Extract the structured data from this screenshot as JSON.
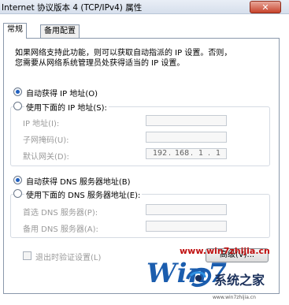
{
  "window": {
    "title": "Internet 协议版本 4 (TCP/IPv4) 属性",
    "close_glyph": "✕"
  },
  "tabs": [
    {
      "label": "常规",
      "selected": true
    },
    {
      "label": "备用配置",
      "selected": false
    }
  ],
  "general": {
    "description_line1": "如果网络支持此功能，则可以获取自动指派的 IP 设置。否则，",
    "description_line2": "您需要从网络系统管理员处获得适当的 IP 设置。",
    "ip_auto_label": "自动获得 IP 地址(O)",
    "ip_manual_label": "使用下面的 IP 地址(S):",
    "ip_address_label": "IP 地址(I):",
    "subnet_mask_label": "子网掩码(U):",
    "default_gateway_label": "默认网关(D):",
    "gateway_value": [
      "192",
      "168",
      "1",
      "1"
    ],
    "dns_auto_label": "自动获得 DNS 服务器地址(B)",
    "dns_manual_label": "使用下面的 DNS 服务器地址(E):",
    "dns_preferred_label": "首选 DNS 服务器(P):",
    "dns_alternate_label": "备用 DNS 服务器(A):",
    "validate_on_exit_label": "退出时验证设置(L)",
    "advanced_button_label": "高级(V)..."
  },
  "watermark": {
    "url": "www.win7zhijia.cn",
    "logo_text": "Win7",
    "brand": "系统之家",
    "site_small": "www.win7zhijia.cn"
  }
}
